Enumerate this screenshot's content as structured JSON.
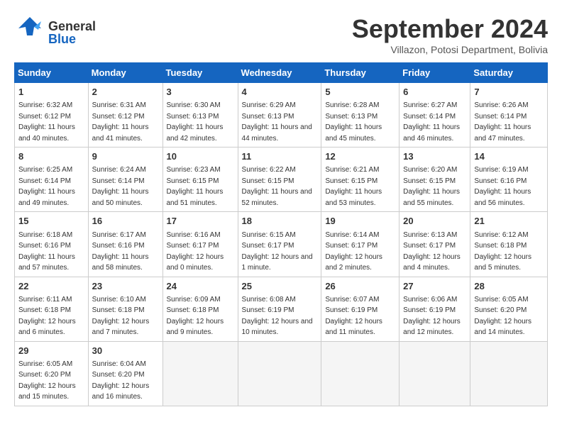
{
  "header": {
    "logo_general": "General",
    "logo_blue": "Blue",
    "month_title": "September 2024",
    "subtitle": "Villazon, Potosi Department, Bolivia"
  },
  "weekdays": [
    "Sunday",
    "Monday",
    "Tuesday",
    "Wednesday",
    "Thursday",
    "Friday",
    "Saturday"
  ],
  "days": [
    {
      "num": "",
      "info": ""
    },
    {
      "num": "",
      "info": ""
    },
    {
      "num": "",
      "info": ""
    },
    {
      "num": "",
      "info": ""
    },
    {
      "num": "",
      "info": ""
    },
    {
      "num": "",
      "info": ""
    },
    {
      "num": "1",
      "sunrise": "Sunrise: 6:32 AM",
      "sunset": "Sunset: 6:12 PM",
      "daylight": "Daylight: 11 hours and 40 minutes."
    },
    {
      "num": "2",
      "sunrise": "Sunrise: 6:31 AM",
      "sunset": "Sunset: 6:12 PM",
      "daylight": "Daylight: 11 hours and 41 minutes."
    },
    {
      "num": "3",
      "sunrise": "Sunrise: 6:30 AM",
      "sunset": "Sunset: 6:13 PM",
      "daylight": "Daylight: 11 hours and 42 minutes."
    },
    {
      "num": "4",
      "sunrise": "Sunrise: 6:29 AM",
      "sunset": "Sunset: 6:13 PM",
      "daylight": "Daylight: 11 hours and 44 minutes."
    },
    {
      "num": "5",
      "sunrise": "Sunrise: 6:28 AM",
      "sunset": "Sunset: 6:13 PM",
      "daylight": "Daylight: 11 hours and 45 minutes."
    },
    {
      "num": "6",
      "sunrise": "Sunrise: 6:27 AM",
      "sunset": "Sunset: 6:14 PM",
      "daylight": "Daylight: 11 hours and 46 minutes."
    },
    {
      "num": "7",
      "sunrise": "Sunrise: 6:26 AM",
      "sunset": "Sunset: 6:14 PM",
      "daylight": "Daylight: 11 hours and 47 minutes."
    },
    {
      "num": "8",
      "sunrise": "Sunrise: 6:25 AM",
      "sunset": "Sunset: 6:14 PM",
      "daylight": "Daylight: 11 hours and 49 minutes."
    },
    {
      "num": "9",
      "sunrise": "Sunrise: 6:24 AM",
      "sunset": "Sunset: 6:14 PM",
      "daylight": "Daylight: 11 hours and 50 minutes."
    },
    {
      "num": "10",
      "sunrise": "Sunrise: 6:23 AM",
      "sunset": "Sunset: 6:15 PM",
      "daylight": "Daylight: 11 hours and 51 minutes."
    },
    {
      "num": "11",
      "sunrise": "Sunrise: 6:22 AM",
      "sunset": "Sunset: 6:15 PM",
      "daylight": "Daylight: 11 hours and 52 minutes."
    },
    {
      "num": "12",
      "sunrise": "Sunrise: 6:21 AM",
      "sunset": "Sunset: 6:15 PM",
      "daylight": "Daylight: 11 hours and 53 minutes."
    },
    {
      "num": "13",
      "sunrise": "Sunrise: 6:20 AM",
      "sunset": "Sunset: 6:15 PM",
      "daylight": "Daylight: 11 hours and 55 minutes."
    },
    {
      "num": "14",
      "sunrise": "Sunrise: 6:19 AM",
      "sunset": "Sunset: 6:16 PM",
      "daylight": "Daylight: 11 hours and 56 minutes."
    },
    {
      "num": "15",
      "sunrise": "Sunrise: 6:18 AM",
      "sunset": "Sunset: 6:16 PM",
      "daylight": "Daylight: 11 hours and 57 minutes."
    },
    {
      "num": "16",
      "sunrise": "Sunrise: 6:17 AM",
      "sunset": "Sunset: 6:16 PM",
      "daylight": "Daylight: 11 hours and 58 minutes."
    },
    {
      "num": "17",
      "sunrise": "Sunrise: 6:16 AM",
      "sunset": "Sunset: 6:17 PM",
      "daylight": "Daylight: 12 hours and 0 minutes."
    },
    {
      "num": "18",
      "sunrise": "Sunrise: 6:15 AM",
      "sunset": "Sunset: 6:17 PM",
      "daylight": "Daylight: 12 hours and 1 minute."
    },
    {
      "num": "19",
      "sunrise": "Sunrise: 6:14 AM",
      "sunset": "Sunset: 6:17 PM",
      "daylight": "Daylight: 12 hours and 2 minutes."
    },
    {
      "num": "20",
      "sunrise": "Sunrise: 6:13 AM",
      "sunset": "Sunset: 6:17 PM",
      "daylight": "Daylight: 12 hours and 4 minutes."
    },
    {
      "num": "21",
      "sunrise": "Sunrise: 6:12 AM",
      "sunset": "Sunset: 6:18 PM",
      "daylight": "Daylight: 12 hours and 5 minutes."
    },
    {
      "num": "22",
      "sunrise": "Sunrise: 6:11 AM",
      "sunset": "Sunset: 6:18 PM",
      "daylight": "Daylight: 12 hours and 6 minutes."
    },
    {
      "num": "23",
      "sunrise": "Sunrise: 6:10 AM",
      "sunset": "Sunset: 6:18 PM",
      "daylight": "Daylight: 12 hours and 7 minutes."
    },
    {
      "num": "24",
      "sunrise": "Sunrise: 6:09 AM",
      "sunset": "Sunset: 6:18 PM",
      "daylight": "Daylight: 12 hours and 9 minutes."
    },
    {
      "num": "25",
      "sunrise": "Sunrise: 6:08 AM",
      "sunset": "Sunset: 6:19 PM",
      "daylight": "Daylight: 12 hours and 10 minutes."
    },
    {
      "num": "26",
      "sunrise": "Sunrise: 6:07 AM",
      "sunset": "Sunset: 6:19 PM",
      "daylight": "Daylight: 12 hours and 11 minutes."
    },
    {
      "num": "27",
      "sunrise": "Sunrise: 6:06 AM",
      "sunset": "Sunset: 6:19 PM",
      "daylight": "Daylight: 12 hours and 12 minutes."
    },
    {
      "num": "28",
      "sunrise": "Sunrise: 6:05 AM",
      "sunset": "Sunset: 6:20 PM",
      "daylight": "Daylight: 12 hours and 14 minutes."
    },
    {
      "num": "29",
      "sunrise": "Sunrise: 6:05 AM",
      "sunset": "Sunset: 6:20 PM",
      "daylight": "Daylight: 12 hours and 15 minutes."
    },
    {
      "num": "30",
      "sunrise": "Sunrise: 6:04 AM",
      "sunset": "Sunset: 6:20 PM",
      "daylight": "Daylight: 12 hours and 16 minutes."
    }
  ]
}
